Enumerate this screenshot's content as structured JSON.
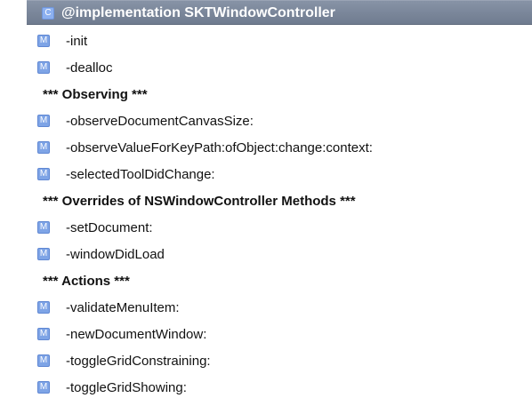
{
  "header": {
    "badge": "C",
    "title": "@implementation SKTWindowController"
  },
  "rows": [
    {
      "type": "method",
      "badge": "M",
      "label": "-init"
    },
    {
      "type": "method",
      "badge": "M",
      "label": "-dealloc"
    },
    {
      "type": "section",
      "label": "*** Observing ***"
    },
    {
      "type": "method",
      "badge": "M",
      "label": "-observeDocumentCanvasSize:"
    },
    {
      "type": "method",
      "badge": "M",
      "label": "-observeValueForKeyPath:ofObject:change:context:"
    },
    {
      "type": "method",
      "badge": "M",
      "label": "-selectedToolDidChange:"
    },
    {
      "type": "section",
      "label": "*** Overrides of NSWindowController Methods ***"
    },
    {
      "type": "method",
      "badge": "M",
      "label": "-setDocument:"
    },
    {
      "type": "method",
      "badge": "M",
      "label": "-windowDidLoad"
    },
    {
      "type": "section",
      "label": "*** Actions ***"
    },
    {
      "type": "method",
      "badge": "M",
      "label": "-validateMenuItem:"
    },
    {
      "type": "method",
      "badge": "M",
      "label": "-newDocumentWindow:"
    },
    {
      "type": "method",
      "badge": "M",
      "label": "-toggleGridConstraining:"
    },
    {
      "type": "method",
      "badge": "M",
      "label": "-toggleGridShowing:"
    }
  ]
}
